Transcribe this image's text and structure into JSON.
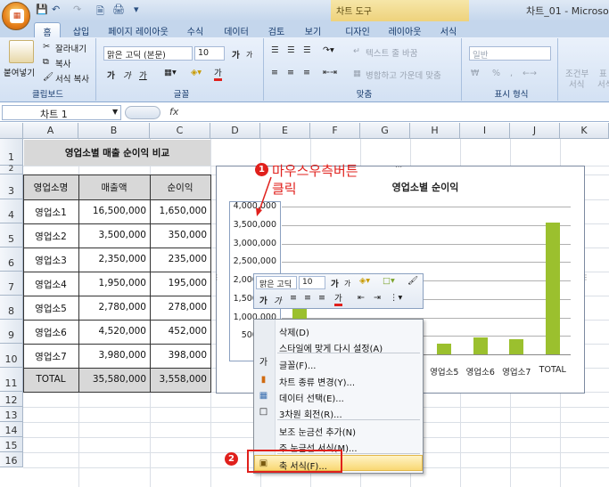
{
  "title_bar": {
    "context_group": "차트 도구",
    "window_title": "차트_01 - Microsoft"
  },
  "tabs": [
    "홈",
    "삽입",
    "페이지 레이아웃",
    "수식",
    "데이터",
    "검토",
    "보기",
    "디자인",
    "레이아웃",
    "서식"
  ],
  "ribbon": {
    "clipboard": {
      "paste": "붙여넣기",
      "cut": "잘라내기",
      "copy": "복사",
      "format_painter": "서식 복사",
      "label": "클립보드"
    },
    "font": {
      "name": "맑은 고딕 (본문)",
      "size": "10",
      "bold": "가",
      "italic": "가",
      "underline": "가",
      "grow": "가",
      "shrink": "가",
      "font_color_glyph": "가",
      "label": "글꼴"
    },
    "alignment": {
      "wrap_text": "텍스트 줄 바꿈",
      "merge_center": "병합하고 가운데 맞춤",
      "label": "맞춤"
    },
    "number": {
      "format": "일반",
      "currency": "₩",
      "percent": "%",
      "comma": ",",
      "label": "표시 형식"
    },
    "styles": {
      "conditional": "조건부",
      "conditional2": "서식",
      "table_format": "표",
      "table_format2": "서식"
    }
  },
  "formula_bar": {
    "name_box": "차트 1",
    "fx": "fx",
    "formula": ""
  },
  "columns": [
    "A",
    "B",
    "C",
    "D",
    "E",
    "F",
    "G",
    "H",
    "I",
    "J",
    "K"
  ],
  "rows": [
    "1",
    "2",
    "3",
    "4",
    "5",
    "6",
    "7",
    "8",
    "9",
    "10",
    "11",
    "12",
    "13",
    "14",
    "15",
    "16"
  ],
  "sheet": {
    "title": "영업소별 매출 순이익 비교",
    "headers": [
      "영업소명",
      "매출액",
      "순이익"
    ],
    "data": [
      [
        "영업소1",
        "16,500,000",
        "1,650,000"
      ],
      [
        "영업소2",
        "3,500,000",
        "350,000"
      ],
      [
        "영업소3",
        "2,350,000",
        "235,000"
      ],
      [
        "영업소4",
        "1,950,000",
        "195,000"
      ],
      [
        "영업소5",
        "2,780,000",
        "278,000"
      ],
      [
        "영업소6",
        "4,520,000",
        "452,000"
      ],
      [
        "영업소7",
        "3,980,000",
        "398,000"
      ],
      [
        "TOTAL",
        "35,580,000",
        "3,558,000"
      ]
    ]
  },
  "chart_data": {
    "type": "bar",
    "title": "영업소별 순이익",
    "categories": [
      "영업소1",
      "영업소2",
      "영업소3",
      "영업소4",
      "영업소5",
      "영업소6",
      "영업소7",
      "TOTAL"
    ],
    "values": [
      1650000,
      350000,
      235000,
      195000,
      278000,
      452000,
      398000,
      3558000
    ],
    "visible_x_labels": [
      "영업소5",
      "영업소6",
      "영업소7",
      "TOTAL"
    ],
    "y_ticks": [
      "500,000",
      "1,000,000",
      "1,500,000",
      "2,000,000",
      "2,500,000",
      "3,000,000",
      "3,500,000",
      "4,000,000"
    ],
    "ylim": [
      0,
      4000000
    ],
    "grid": true,
    "color": "#9bc02e"
  },
  "mini_toolbar": {
    "font": "맑은 고딕",
    "size": "10"
  },
  "context_menu": {
    "items": [
      {
        "label": "삭제(D)",
        "enabled": true
      },
      {
        "label": "스타일에 맞게 다시 설정(A)",
        "enabled": true
      },
      {
        "label": "글꼴(F)...",
        "enabled": true
      },
      {
        "label": "차트 종류 변경(Y)...",
        "enabled": true
      },
      {
        "label": "데이터 선택(E)...",
        "enabled": true
      },
      {
        "label": "3차원 회전(R)...",
        "enabled": false
      },
      {
        "label": "보조 눈금선 추가(N)",
        "enabled": true
      },
      {
        "label": "주 눈금선 서식(M)...",
        "enabled": true
      },
      {
        "label": "축 서식(F)...",
        "enabled": true,
        "highlighted": true
      }
    ]
  },
  "annotations": {
    "step1_number": "1",
    "step1_line1": "마우스우측버튼",
    "step1_line2": "클릭",
    "step2_number": "2",
    "color": "#e0201c"
  }
}
